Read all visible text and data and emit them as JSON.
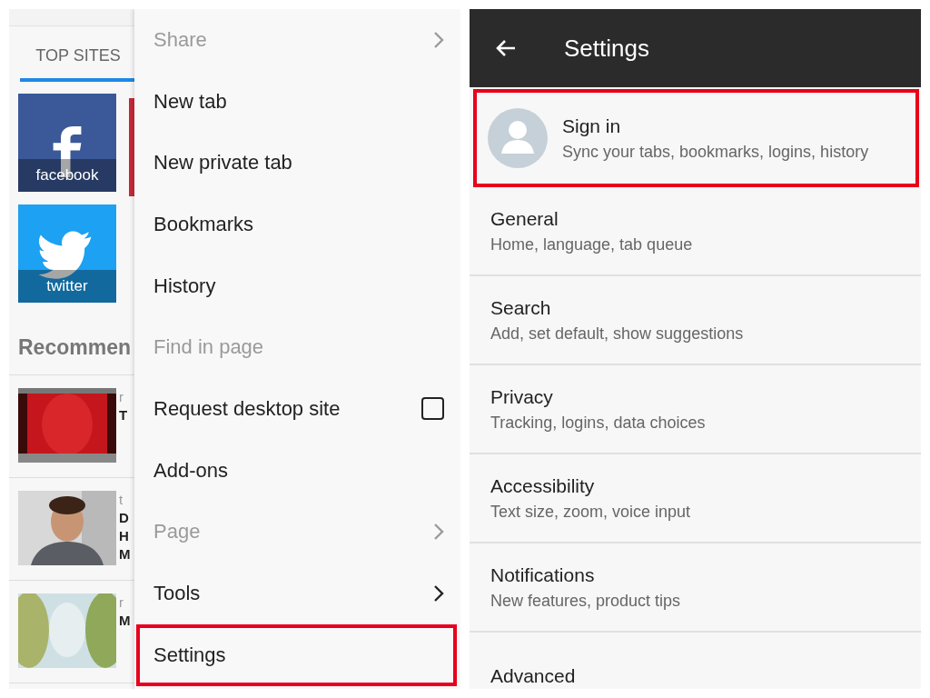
{
  "home": {
    "tabs": [
      {
        "label": "TOP SITES",
        "selected": true
      }
    ],
    "top_sites": [
      {
        "label": "facebook",
        "kind": "facebook"
      },
      {
        "label": "twitter",
        "kind": "twitter"
      }
    ],
    "recommended": {
      "heading": "Recommen",
      "items": [
        {
          "meta": "r",
          "title_lines": [
            "T"
          ]
        },
        {
          "meta": "t",
          "title_lines": [
            "D",
            "H",
            "M"
          ]
        },
        {
          "meta": "r",
          "title_lines": [
            "M"
          ]
        }
      ]
    }
  },
  "menu": {
    "items": [
      {
        "label": "Share",
        "kind": "submenu",
        "disabled": true,
        "highlighted": false
      },
      {
        "label": "New tab",
        "kind": "plain",
        "disabled": false,
        "highlighted": false
      },
      {
        "label": "New private tab",
        "kind": "plain",
        "disabled": false,
        "highlighted": false
      },
      {
        "label": "Bookmarks",
        "kind": "plain",
        "disabled": false,
        "highlighted": false
      },
      {
        "label": "History",
        "kind": "plain",
        "disabled": false,
        "highlighted": false
      },
      {
        "label": "Find in page",
        "kind": "plain",
        "disabled": true,
        "highlighted": false
      },
      {
        "label": "Request desktop site",
        "kind": "checkbox",
        "checked": false,
        "disabled": false,
        "highlighted": false
      },
      {
        "label": "Add-ons",
        "kind": "plain",
        "disabled": false,
        "highlighted": false
      },
      {
        "label": "Page",
        "kind": "submenu",
        "disabled": true,
        "highlighted": false
      },
      {
        "label": "Tools",
        "kind": "submenu",
        "disabled": false,
        "highlighted": false
      },
      {
        "label": "Settings",
        "kind": "plain",
        "disabled": false,
        "highlighted": true
      }
    ]
  },
  "settings": {
    "title": "Settings",
    "items": [
      {
        "kind": "account",
        "title": "Sign in",
        "subtitle": "Sync your tabs, bookmarks, logins, history",
        "highlighted": true
      },
      {
        "kind": "section",
        "title": "General",
        "subtitle": "Home, language, tab queue",
        "highlighted": false
      },
      {
        "kind": "section",
        "title": "Search",
        "subtitle": "Add, set default, show suggestions",
        "highlighted": false
      },
      {
        "kind": "section",
        "title": "Privacy",
        "subtitle": "Tracking, logins, data choices",
        "highlighted": false
      },
      {
        "kind": "section",
        "title": "Accessibility",
        "subtitle": "Text size, zoom, voice input",
        "highlighted": false
      },
      {
        "kind": "section",
        "title": "Notifications",
        "subtitle": "New features, product tips",
        "highlighted": false
      },
      {
        "kind": "section",
        "title": "Advanced",
        "highlighted": false
      }
    ]
  }
}
